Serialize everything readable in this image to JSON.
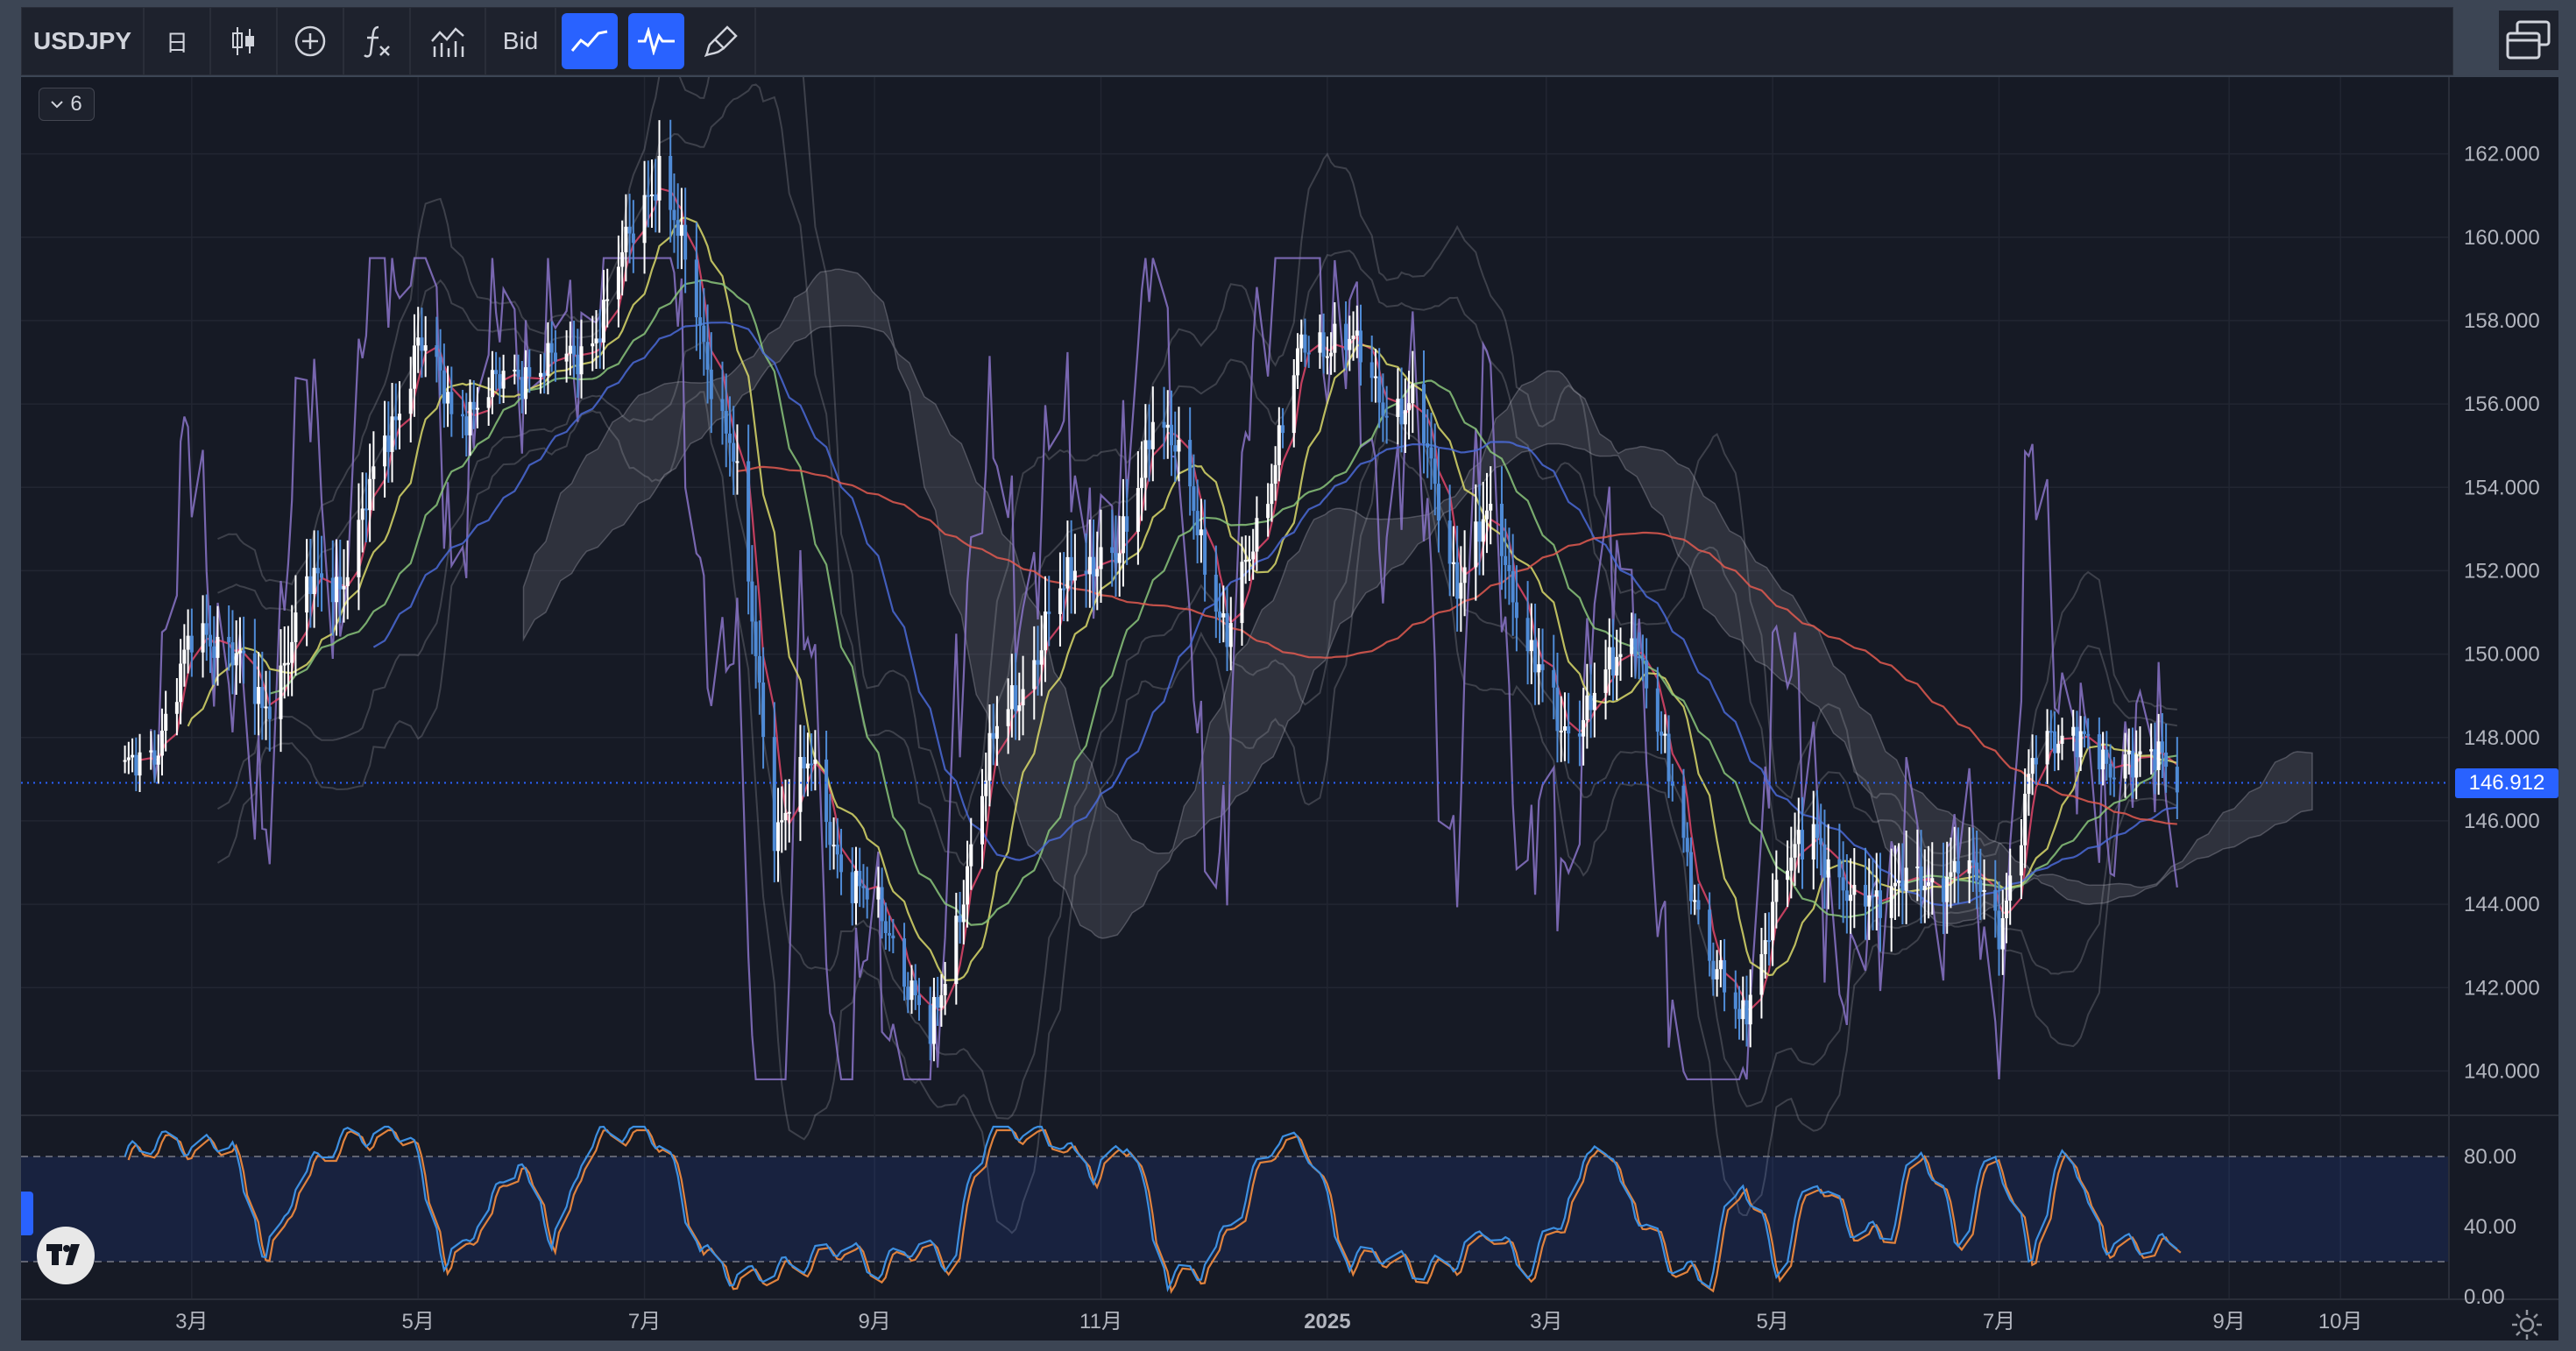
{
  "toolbar": {
    "symbol": "USDJPY",
    "interval": "日",
    "bid_label": "Bid",
    "icons": [
      "candles-icon",
      "add-compare-icon",
      "indicators-icon",
      "indicator-templates-icon",
      "line-chart-icon",
      "oscillator-icon",
      "brush-icon",
      "layout-icon"
    ]
  },
  "legend_toggle": {
    "count": "6"
  },
  "price_axis": {
    "labels": [
      "162.000",
      "160.000",
      "158.000",
      "156.000",
      "154.000",
      "152.000",
      "150.000",
      "148.000",
      "146.000",
      "144.000",
      "142.000",
      "140.000"
    ],
    "current_price": "146.912"
  },
  "osc_axis": {
    "labels": [
      "80.00",
      "40.00",
      "0.00"
    ]
  },
  "time_axis": {
    "labels": [
      "3月",
      "5月",
      "7月",
      "9月",
      "11月",
      "2025",
      "3月",
      "5月",
      "7月",
      "9月",
      "10月"
    ]
  },
  "colors": {
    "bull": "#ffffff",
    "bear": "#4f8bd6",
    "ma_short": "#e0466a",
    "ma_mid": "#d9d96a",
    "ma_long": "#4a6ad6",
    "ma_200": "#e05a50",
    "rsi": "#8a74c8",
    "stoch_k": "#3d8fe0",
    "stoch_d": "#e0823d",
    "current_line": "#2962ff"
  },
  "chart_data": {
    "type": "line",
    "title": "USDJPY",
    "xlabel": "",
    "ylabel": "",
    "ylim": [
      139,
      163
    ],
    "x": [
      "2024-02-10",
      "2024-02-20",
      "2024-03-01",
      "2024-03-10",
      "2024-03-20",
      "2024-04-01",
      "2024-04-10",
      "2024-04-20",
      "2024-05-01",
      "2024-05-10",
      "2024-05-20",
      "2024-06-01",
      "2024-06-10",
      "2024-06-20",
      "2024-07-01",
      "2024-07-05",
      "2024-07-15",
      "2024-07-25",
      "2024-08-05",
      "2024-08-15",
      "2024-08-25",
      "2024-09-05",
      "2024-09-16",
      "2024-09-25",
      "2024-10-05",
      "2024-10-15",
      "2024-10-25",
      "2024-11-05",
      "2024-11-15",
      "2024-11-25",
      "2024-12-05",
      "2024-12-15",
      "2024-12-25",
      "2025-01-05",
      "2025-01-15",
      "2025-01-25",
      "2025-02-05",
      "2025-02-15",
      "2025-02-25",
      "2025-03-05",
      "2025-03-15",
      "2025-03-25",
      "2025-04-05",
      "2025-04-15",
      "2025-04-22",
      "2025-05-01",
      "2025-05-12",
      "2025-05-22",
      "2025-06-01",
      "2025-06-10",
      "2025-06-20",
      "2025-07-01",
      "2025-07-10",
      "2025-07-20",
      "2025-07-30",
      "2025-08-05",
      "2025-08-12",
      "2025-08-18"
    ],
    "series": [
      {
        "values": [
          146.8,
          147.8,
          150.2,
          150.6,
          148.5,
          151.5,
          151.8,
          154.3,
          157.6,
          155.8,
          156.2,
          157.0,
          156.9,
          158.1,
          161.0,
          161.7,
          158.2,
          154.7,
          145.9,
          147.3,
          144.5,
          143.5,
          140.6,
          144.5,
          148.6,
          149.9,
          152.4,
          152.0,
          155.8,
          154.0,
          150.2,
          153.8,
          157.2,
          157.8,
          156.2,
          155.8,
          151.8,
          153.4,
          149.9,
          148.2,
          149.0,
          150.6,
          146.2,
          142.5,
          141.0,
          144.0,
          146.0,
          143.8,
          144.6,
          144.3,
          145.1,
          143.5,
          147.2,
          148.5,
          147.0,
          147.8,
          147.4,
          146.9
        ]
      }
    ],
    "current_price": 146.912,
    "oscillator": {
      "type": "stochastic",
      "ylim": [
        0,
        100
      ],
      "bands": [
        80,
        20
      ],
      "k": [
        80,
        90,
        85,
        90,
        20,
        70,
        90,
        92,
        95,
        15,
        45,
        80,
        30,
        90,
        95,
        90,
        30,
        10,
        15,
        20,
        30,
        15,
        30,
        20,
        95,
        95,
        90,
        70,
        90,
        10,
        15,
        50,
        90,
        85,
        20,
        25,
        15,
        20,
        40,
        15,
        45,
        92,
        50,
        20,
        10,
        70,
        15,
        70,
        40,
        35,
        88,
        30,
        85,
        20,
        88,
        30,
        30,
        30
      ]
    }
  }
}
